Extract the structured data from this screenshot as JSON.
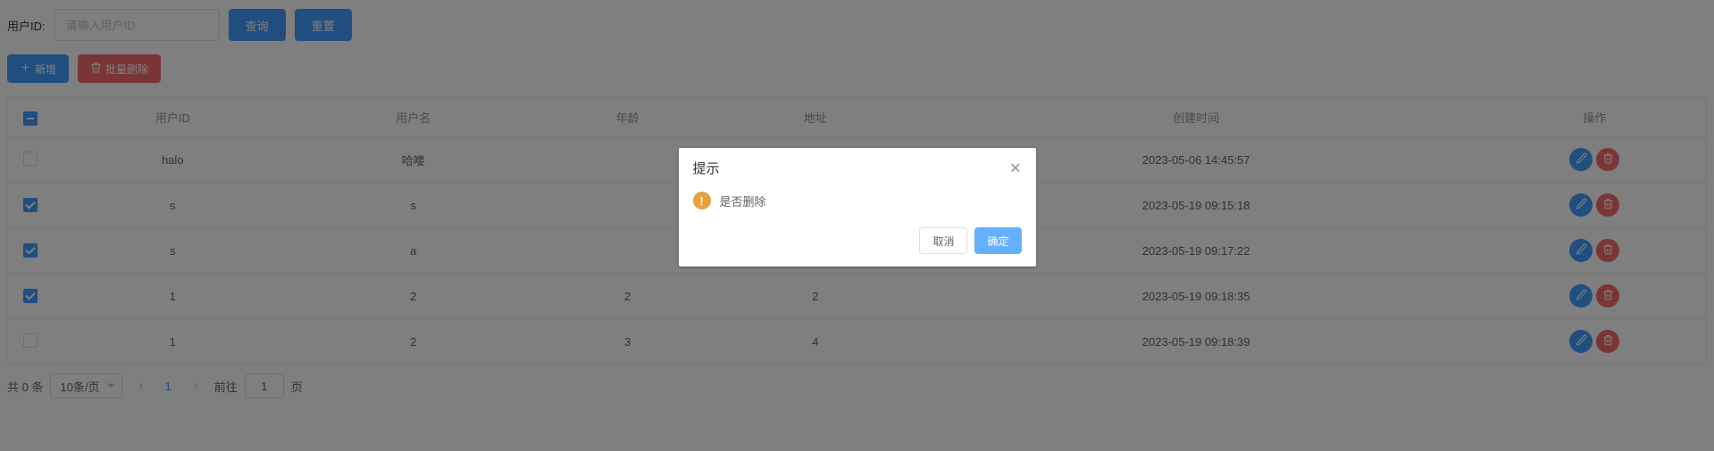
{
  "search": {
    "label": "用户ID:",
    "placeholder": "请输入用户ID",
    "value": "",
    "query_btn": "查询",
    "reset_btn": "重置"
  },
  "actions": {
    "add_btn": "新增",
    "batch_delete_btn": "批量删除"
  },
  "table": {
    "header_check_state": "indeterminate",
    "columns": {
      "user_id": "用户ID",
      "username": "用户名",
      "age": "年龄",
      "address": "地址",
      "created_at": "创建时间",
      "ops": "操作"
    },
    "rows": [
      {
        "checked": false,
        "user_id": "halo",
        "username": "哈喽",
        "age": "",
        "address": "",
        "created_at": "2023-05-06 14:45:57"
      },
      {
        "checked": true,
        "user_id": "s",
        "username": "s",
        "age": "",
        "address": "",
        "created_at": "2023-05-19 09:15:18"
      },
      {
        "checked": true,
        "user_id": "s",
        "username": "a",
        "age": "",
        "address": "",
        "created_at": "2023-05-19 09:17:22"
      },
      {
        "checked": true,
        "user_id": "1",
        "username": "2",
        "age": "2",
        "address": "2",
        "created_at": "2023-05-19 09:18:35"
      },
      {
        "checked": false,
        "user_id": "1",
        "username": "2",
        "age": "3",
        "address": "4",
        "created_at": "2023-05-19 09:18:39"
      }
    ]
  },
  "pager": {
    "total_text": "共 0 条",
    "page_size_label": "10条/页",
    "current_page": "1",
    "goto_prefix": "前往",
    "goto_value": "1",
    "goto_suffix": "页"
  },
  "dialog": {
    "title": "提示",
    "message": "是否删除",
    "cancel": "取消",
    "confirm": "确定"
  }
}
